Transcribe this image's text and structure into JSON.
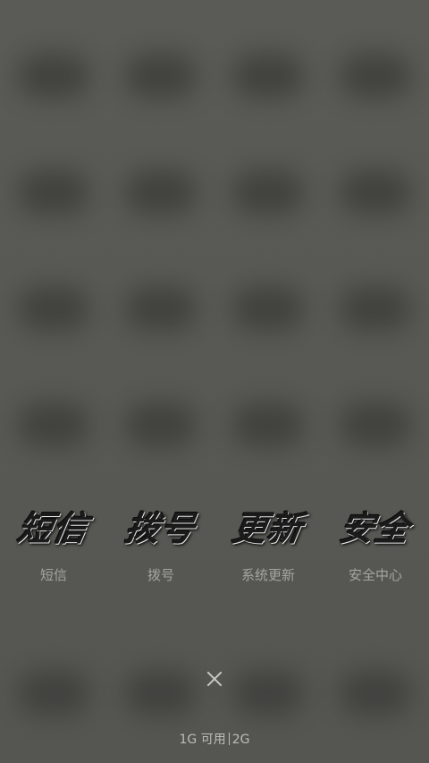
{
  "recent_apps": [
    {
      "icon_text": "短信",
      "label": "短信",
      "name": "messages"
    },
    {
      "icon_text": "拨号",
      "label": "拨号",
      "name": "dialer"
    },
    {
      "icon_text": "更新",
      "label": "系统更新",
      "name": "system-update"
    },
    {
      "icon_text": "安全",
      "label": "安全中心",
      "name": "security-center"
    }
  ],
  "memory": {
    "available": "1G 可用",
    "total": "2G"
  },
  "colors": {
    "background": "#585854",
    "label": "#a5a5a0"
  }
}
